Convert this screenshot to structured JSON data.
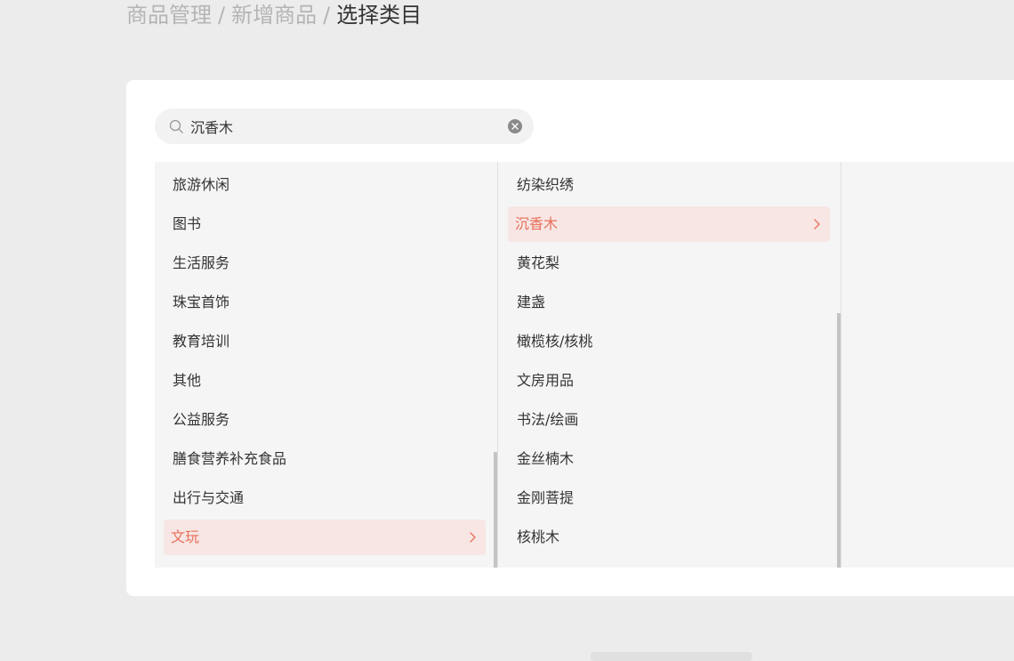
{
  "breadcrumb": {
    "items": [
      "商品管理",
      "新增商品",
      "选择类目"
    ],
    "separator": "/"
  },
  "search": {
    "value": "沉香木",
    "placeholder": ""
  },
  "colors": {
    "accent": "#e8705a",
    "active_bg": "#f7e6e4"
  },
  "categories": {
    "level1": {
      "items": [
        "旅游休闲",
        "图书",
        "生活服务",
        "珠宝首饰",
        "教育培训",
        "其他",
        "公益服务",
        "膳食营养补充食品",
        "出行与交通",
        "文玩"
      ],
      "selected": "文玩"
    },
    "level2": {
      "items": [
        "纺染织绣",
        "沉香木",
        "黄花梨",
        "建盏",
        "橄榄核/核桃",
        "文房用品",
        "书法/绘画",
        "金丝楠木",
        "金刚菩提",
        "核桃木"
      ],
      "selected": "沉香木"
    }
  }
}
